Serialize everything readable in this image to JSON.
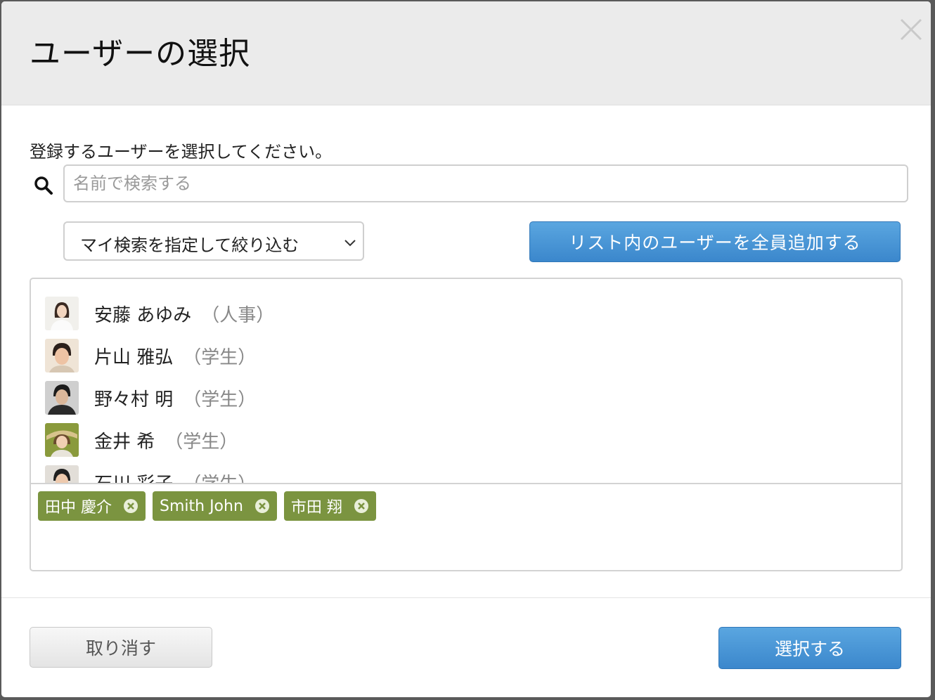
{
  "dialog": {
    "title": "ユーザーの選択",
    "instruction": "登録するユーザーを選択してください。"
  },
  "search": {
    "placeholder": "名前で検索する",
    "value": ""
  },
  "filter": {
    "label": "マイ検索を指定して絞り込む"
  },
  "actions": {
    "add_all_label": "リスト内のユーザーを全員追加する",
    "cancel_label": "取り消す",
    "select_label": "選択する"
  },
  "users": [
    {
      "name": "安藤 あゆみ",
      "role": "（人事）",
      "avatar": "female-portrait"
    },
    {
      "name": "片山 雅弘",
      "role": "（学生）",
      "avatar": "male-portrait"
    },
    {
      "name": "野々村 明",
      "role": "（学生）",
      "avatar": "male-portrait"
    },
    {
      "name": "金井 希",
      "role": "（学生）",
      "avatar": "female-portrait"
    },
    {
      "name": "石川 彩子",
      "role": "（学生）",
      "avatar": "male-portrait"
    }
  ],
  "selected": [
    {
      "label": "田中 慶介"
    },
    {
      "label": "Smith John"
    },
    {
      "label": "市田 翔"
    }
  ],
  "icons": {
    "close": "close-icon",
    "search": "search-icon",
    "chevron": "chevron-down-icon",
    "remove": "remove-chip-icon"
  },
  "colors": {
    "primary_button": "#3b87cc",
    "chip": "#7b9440",
    "header_bg": "#ebebeb"
  }
}
